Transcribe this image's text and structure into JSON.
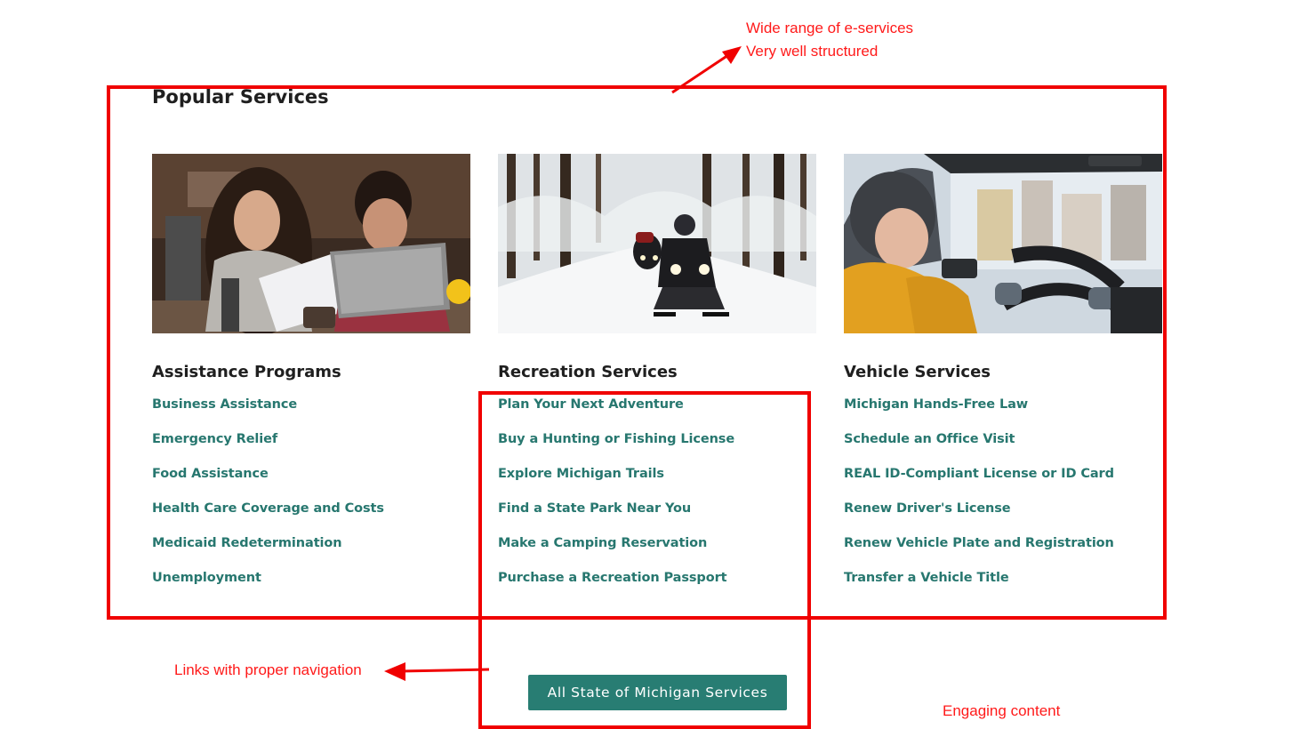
{
  "section": {
    "title": "Popular Services"
  },
  "cards": [
    {
      "image_label": "couple-reviewing-bills-photo",
      "title": "Assistance Programs",
      "links": [
        "Business Assistance",
        "Emergency Relief",
        "Food Assistance",
        "Health Care Coverage and Costs",
        "Medicaid Redetermination",
        "Unemployment"
      ]
    },
    {
      "image_label": "snowmobile-forest-photo",
      "title": "Recreation Services",
      "links": [
        "Plan Your Next Adventure",
        "Buy a Hunting or Fishing License",
        "Explore Michigan Trails",
        "Find a State Park Near You",
        "Make a Camping Reservation",
        "Purchase a Recreation Passport"
      ]
    },
    {
      "image_label": "woman-driving-car-photo",
      "title": "Vehicle Services",
      "links": [
        "Michigan Hands-Free Law",
        "Schedule an Office Visit",
        "REAL ID-Compliant License or ID Card",
        "Renew Driver's License",
        "Renew Vehicle Plate and Registration",
        "Transfer a Vehicle Title"
      ]
    }
  ],
  "all_services_button": "All State of Michigan Services",
  "annotations": {
    "top_line1": "Wide range of e-services",
    "top_line2": "Very well structured",
    "links_note": "Links with proper navigation",
    "engaging_note": "Engaging content"
  },
  "colors": {
    "link": "#27776f",
    "button": "#287d73",
    "annotation": "#ff1a1a"
  }
}
